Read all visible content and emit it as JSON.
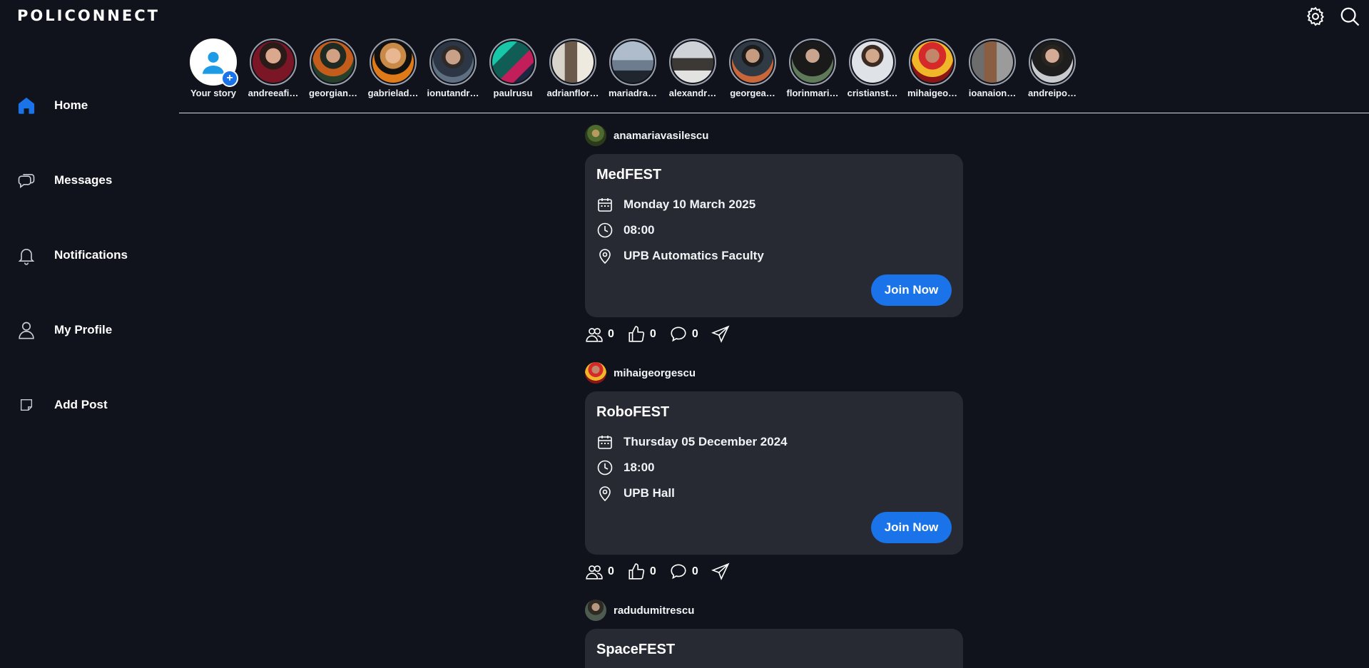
{
  "app": {
    "logo": "POLICONNECT"
  },
  "topbar": {
    "icons": [
      "gear-icon",
      "search-icon"
    ]
  },
  "sidebar": {
    "items": [
      {
        "label": "Home",
        "icon": "home-icon",
        "active": true
      },
      {
        "label": "Messages",
        "icon": "chat-icon"
      },
      {
        "label": "Notifications",
        "icon": "bell-icon"
      },
      {
        "label": "My Profile",
        "icon": "user-icon"
      },
      {
        "label": "Add Post",
        "icon": "note-icon"
      }
    ]
  },
  "stories": [
    {
      "name": "Your story"
    },
    {
      "name": "andreeafi…"
    },
    {
      "name": "georgian…"
    },
    {
      "name": "gabrielad…"
    },
    {
      "name": "ionutandr…"
    },
    {
      "name": "paulrusu"
    },
    {
      "name": "adrianflor…"
    },
    {
      "name": "mariadra…"
    },
    {
      "name": "alexandr…"
    },
    {
      "name": "georgea…"
    },
    {
      "name": "florinmari…"
    },
    {
      "name": "cristianst…"
    },
    {
      "name": "mihaigeo…"
    },
    {
      "name": "ioanaion…"
    },
    {
      "name": "andreipo…"
    }
  ],
  "feed": {
    "posts": [
      {
        "user": "anamariavasilescu",
        "title": "MedFEST",
        "date": "Monday 10 March 2025",
        "time": "08:00",
        "location": "UPB Automatics Faculty",
        "join_label": "Join Now",
        "participants": "0",
        "likes": "0",
        "comments": "0"
      },
      {
        "user": "mihaigeorgescu",
        "title": "RoboFEST",
        "date": "Thursday 05 December 2024",
        "time": "18:00",
        "location": "UPB Hall",
        "join_label": "Join Now",
        "participants": "0",
        "likes": "0",
        "comments": "0"
      },
      {
        "user": "radudumitrescu",
        "title": "SpaceFEST"
      }
    ]
  },
  "colors": {
    "background": "#10131c",
    "card": "#272a33",
    "accent": "#1a73e8"
  }
}
